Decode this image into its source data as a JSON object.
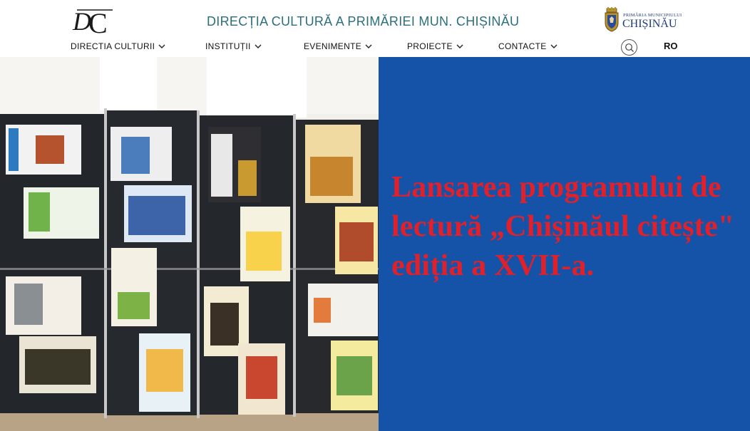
{
  "header": {
    "site_title": "DIRECȚIA CULTURĂ A PRIMĂRIEI MUN. CHIȘINĂU",
    "logo_text": "DC",
    "pmc_logo_small": "PRIMĂRIA MUNICIPIULUI",
    "pmc_logo_big": "CHIȘINĂU"
  },
  "nav": {
    "items": [
      {
        "label": "DIRECTIA CULTURII",
        "icon": "chevron-down-icon"
      },
      {
        "label": "INSTITUȚII",
        "icon": "chevron-down-icon"
      },
      {
        "label": "EVENIMENTE",
        "icon": "chevron-down-icon"
      },
      {
        "label": "PROIECTE",
        "icon": "chevron-down-icon"
      },
      {
        "label": "CONTACTE",
        "icon": "chevron-down-icon"
      }
    ],
    "search_icon": "search-icon",
    "language": "RO"
  },
  "hero": {
    "announcement": "Lansarea programului de lectură „Chișinăul citește\" ediția a XVII-a.",
    "announcement_color": "#e0202a",
    "panel_color": "#1553a8"
  },
  "colors": {
    "title_teal": "#2b6f7f",
    "brand_navy": "#1e3a7a"
  }
}
